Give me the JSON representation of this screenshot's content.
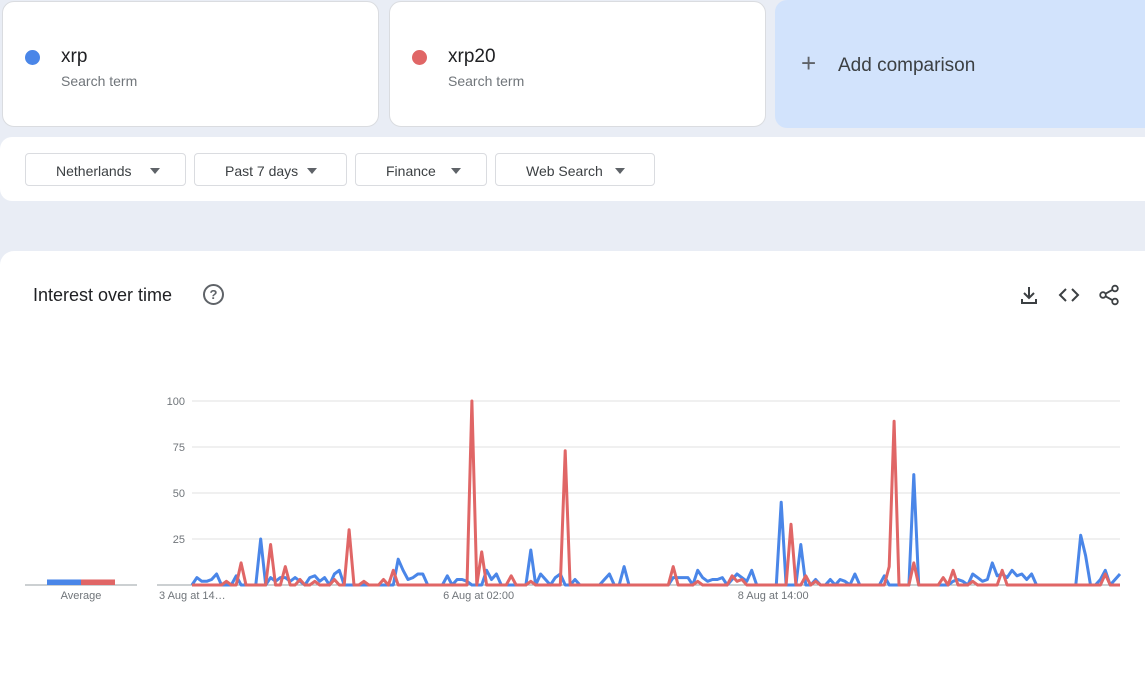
{
  "terms": [
    {
      "name": "xrp",
      "sub": "Search term",
      "color": "#4a86e8"
    },
    {
      "name": "xrp20",
      "sub": "Search term",
      "color": "#e06666"
    }
  ],
  "add_comparison": {
    "label": "Add comparison",
    "icon": "plus-icon"
  },
  "filters": [
    {
      "label": "Netherlands"
    },
    {
      "label": "Past 7 days"
    },
    {
      "label": "Finance"
    },
    {
      "label": "Web Search"
    }
  ],
  "panel": {
    "title": "Interest over time",
    "icons": [
      "help-icon",
      "download-icon",
      "embed-code-icon",
      "share-icon"
    ]
  },
  "chart_data": {
    "type": "line",
    "title": "Interest over time",
    "xlabel": "",
    "ylabel": "",
    "ylim": [
      0,
      100
    ],
    "y_ticks": [
      25,
      50,
      75,
      100
    ],
    "x_tick_labels": [
      "3 Aug at 14…",
      "6 Aug at 02:00",
      "8 Aug at 14:00"
    ],
    "x_tick_indices": [
      0,
      60,
      120
    ],
    "average_label": "Average",
    "averages": [
      {
        "name": "xrp",
        "value": 3
      },
      {
        "name": "xrp20",
        "value": 3
      }
    ],
    "grid": true,
    "series": [
      {
        "name": "xrp",
        "color": "#4a86e8",
        "values": [
          0,
          4,
          2,
          2,
          3,
          6,
          0,
          0,
          0,
          5,
          0,
          0,
          0,
          0,
          25,
          0,
          4,
          2,
          4,
          4,
          2,
          4,
          2,
          0,
          4,
          5,
          2,
          4,
          0,
          6,
          8,
          0,
          0,
          0,
          0,
          0,
          0,
          0,
          0,
          0,
          0,
          0,
          14,
          8,
          3,
          4,
          6,
          6,
          0,
          0,
          0,
          0,
          5,
          0,
          3,
          3,
          2,
          0,
          0,
          0,
          8,
          3,
          6,
          0,
          0,
          0,
          0,
          0,
          0,
          19,
          0,
          6,
          3,
          0,
          4,
          6,
          0,
          0,
          3,
          0,
          0,
          0,
          0,
          0,
          3,
          6,
          0,
          0,
          10,
          0,
          0,
          0,
          0,
          0,
          0,
          0,
          0,
          0,
          4,
          4,
          4,
          4,
          0,
          8,
          4,
          2,
          3,
          3,
          4,
          0,
          3,
          6,
          4,
          2,
          8,
          0,
          0,
          0,
          0,
          0,
          45,
          0,
          0,
          0,
          22,
          0,
          0,
          3,
          0,
          0,
          3,
          0,
          3,
          2,
          0,
          6,
          0,
          0,
          0,
          0,
          0,
          5,
          0,
          0,
          0,
          0,
          0,
          60,
          0,
          0,
          0,
          0,
          0,
          0,
          0,
          2,
          3,
          2,
          0,
          6,
          4,
          2,
          3,
          12,
          5,
          6,
          4,
          8,
          5,
          6,
          3,
          6,
          0,
          0,
          0,
          0,
          0,
          0,
          0,
          0,
          0,
          27,
          16,
          0,
          0,
          3,
          8,
          0,
          3,
          6
        ]
      },
      {
        "name": "xrp20",
        "color": "#e06666",
        "values": [
          0,
          0,
          0,
          0,
          0,
          0,
          0,
          2,
          0,
          0,
          12,
          0,
          0,
          0,
          0,
          0,
          22,
          0,
          0,
          10,
          0,
          0,
          3,
          0,
          0,
          2,
          0,
          0,
          0,
          3,
          0,
          0,
          30,
          0,
          0,
          2,
          0,
          0,
          0,
          3,
          0,
          8,
          0,
          0,
          0,
          0,
          0,
          0,
          0,
          0,
          0,
          0,
          0,
          0,
          0,
          0,
          0,
          100,
          0,
          18,
          0,
          0,
          0,
          0,
          0,
          5,
          0,
          0,
          0,
          2,
          0,
          0,
          0,
          0,
          0,
          0,
          73,
          0,
          0,
          0,
          0,
          0,
          0,
          0,
          0,
          0,
          0,
          0,
          0,
          0,
          0,
          0,
          0,
          0,
          0,
          0,
          0,
          0,
          10,
          0,
          0,
          0,
          0,
          2,
          0,
          0,
          0,
          0,
          0,
          0,
          5,
          2,
          3,
          0,
          0,
          0,
          0,
          0,
          0,
          0,
          0,
          0,
          33,
          0,
          0,
          5,
          0,
          2,
          0,
          0,
          0,
          0,
          0,
          0,
          0,
          0,
          0,
          0,
          0,
          0,
          0,
          0,
          10,
          89,
          0,
          0,
          0,
          12,
          0,
          0,
          0,
          0,
          0,
          4,
          0,
          8,
          0,
          0,
          0,
          2,
          0,
          0,
          0,
          0,
          0,
          8,
          0,
          0,
          0,
          0,
          0,
          0,
          0,
          0,
          0,
          0,
          0,
          0,
          0,
          0,
          0,
          0,
          0,
          0,
          0,
          0,
          6,
          0,
          0,
          0
        ]
      }
    ]
  }
}
